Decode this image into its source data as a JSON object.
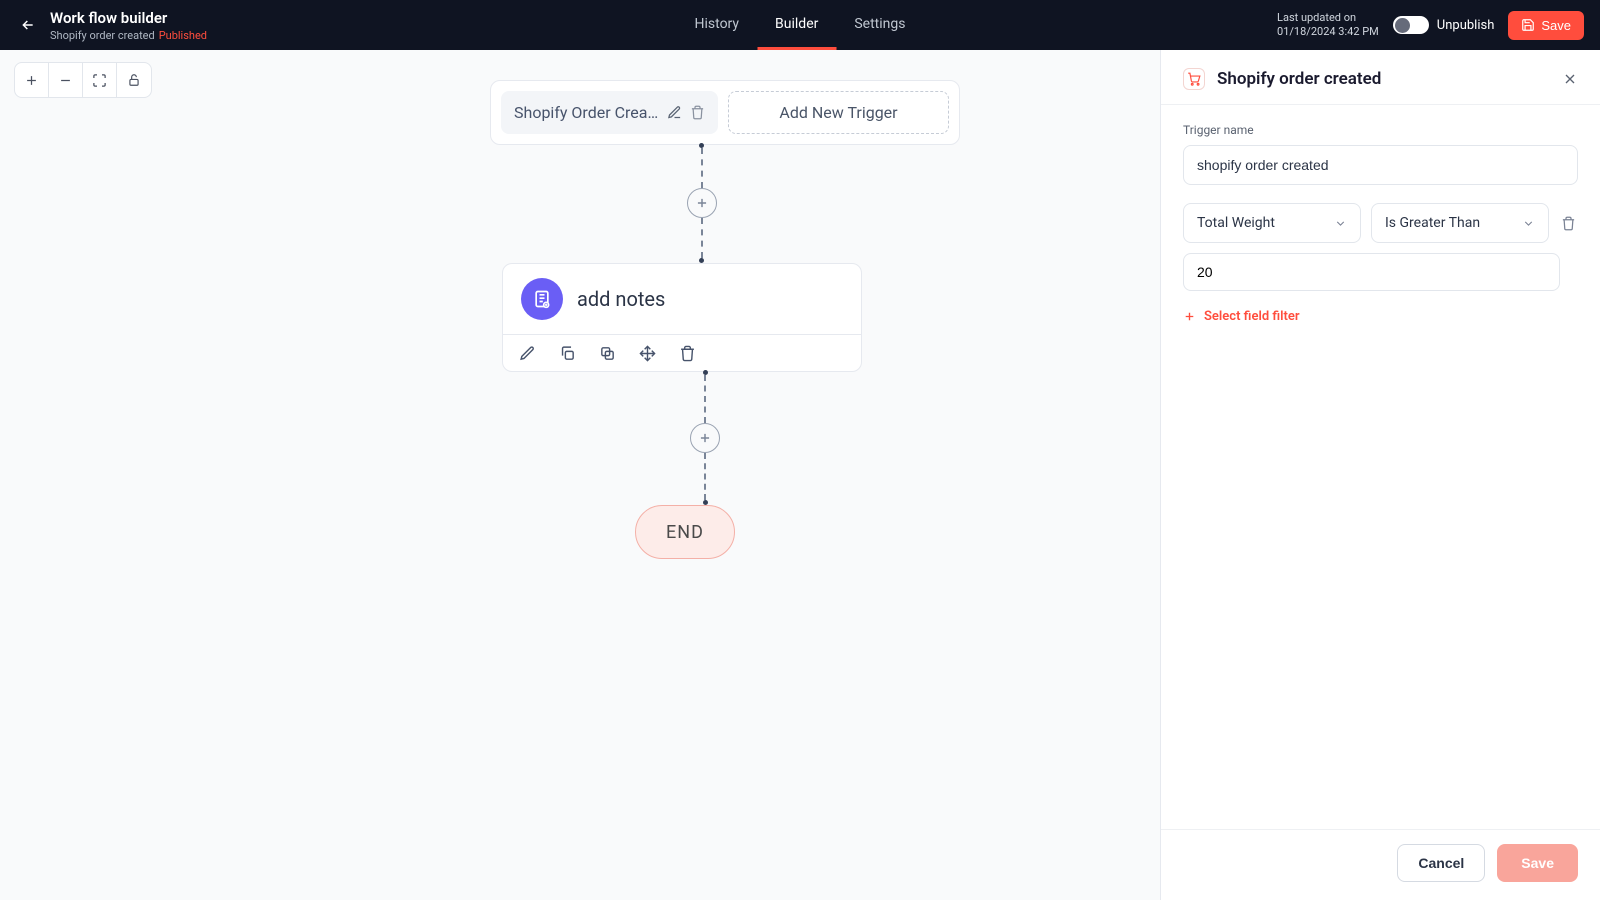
{
  "header": {
    "title": "Work flow builder",
    "subtitle": "Shopify order created",
    "status": "Published",
    "tabs": [
      "History",
      "Builder",
      "Settings"
    ],
    "active_tab": 1,
    "updated_label": "Last updated on",
    "updated_value": "01/18/2024 3:42 PM",
    "unpublish": "Unpublish",
    "save": "Save"
  },
  "flow": {
    "trigger_name_display": "Shopify Order Created",
    "add_trigger": "Add New Trigger",
    "action_title": "add notes",
    "end": "END"
  },
  "panel": {
    "title": "Shopify order created",
    "trigger_name_label": "Trigger name",
    "trigger_name_value": "shopify order created",
    "filter_field": "Total Weight",
    "filter_op": "Is Greater Than",
    "filter_value": "20",
    "add_filter": "Select field filter",
    "cancel": "Cancel",
    "save": "Save"
  },
  "colors": {
    "accent": "#ff4d3d",
    "action": "#6a5ef5"
  }
}
